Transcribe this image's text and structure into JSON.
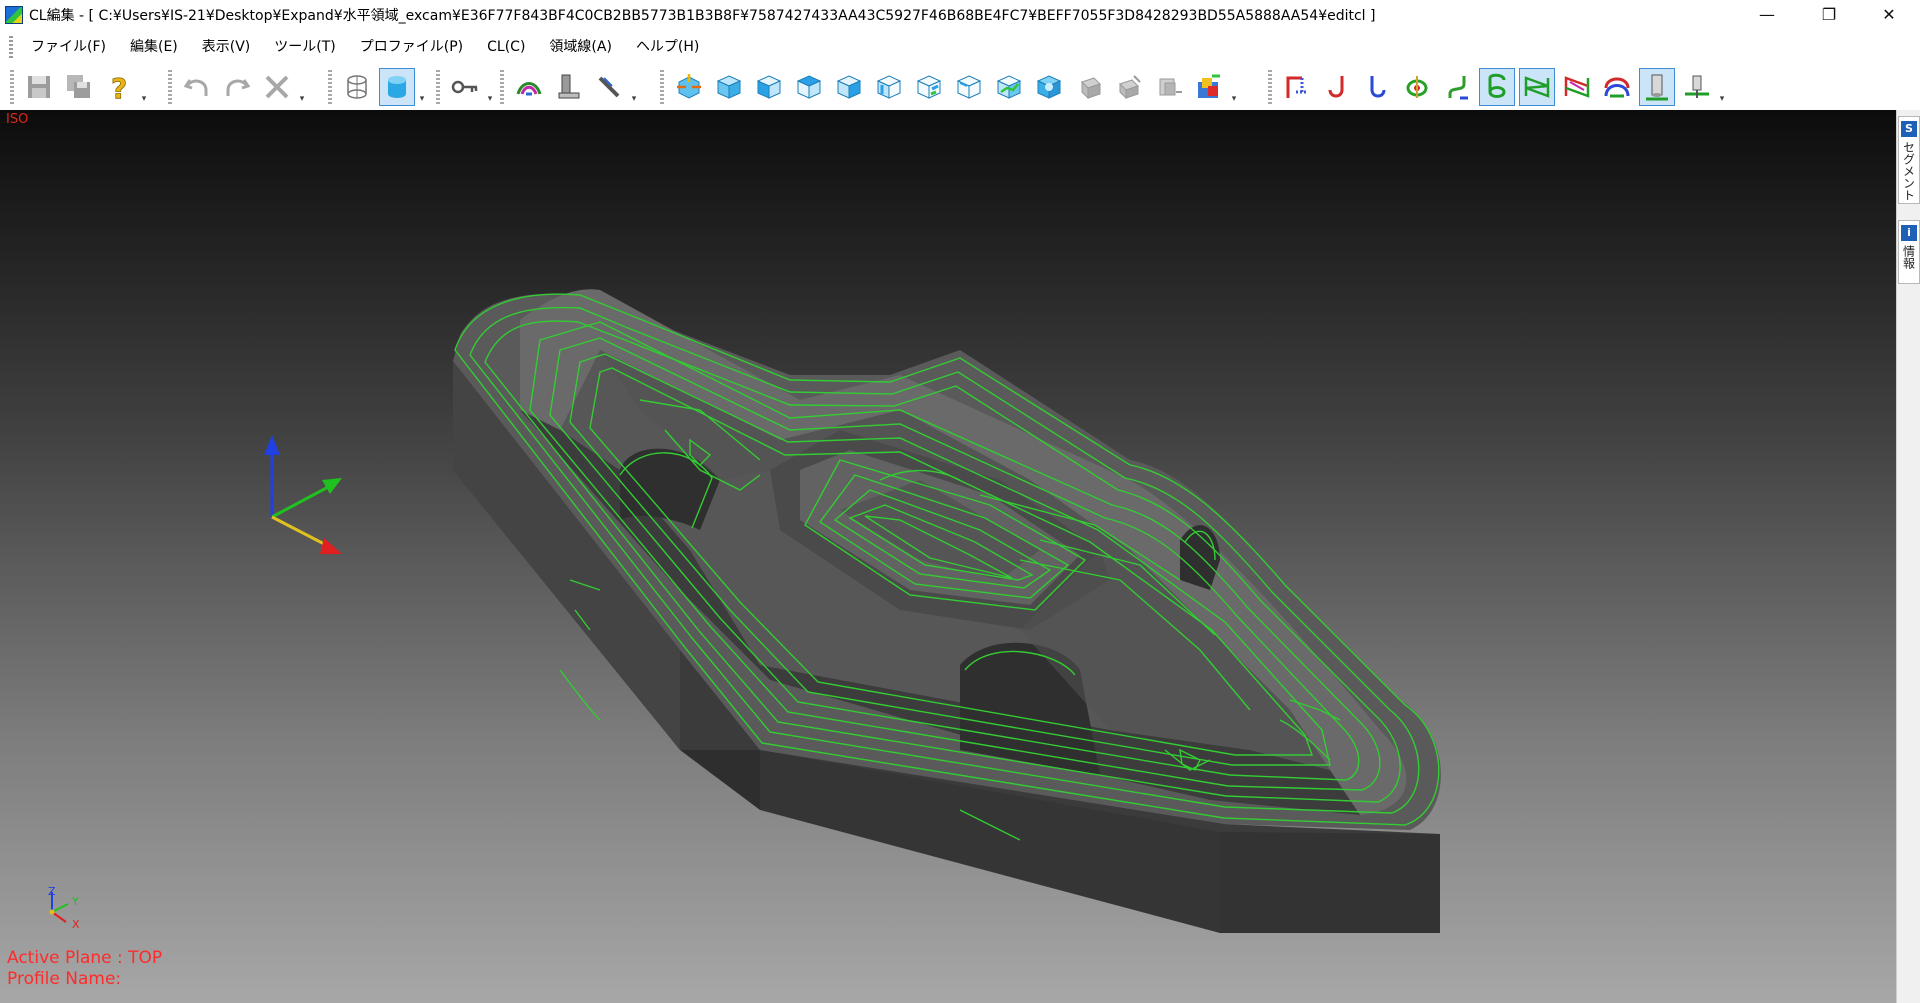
{
  "window": {
    "title": "CL編集 - [ C:¥Users¥IS-21¥Desktop¥Expand¥水平領域_excam¥E36F77F843BF4C0CB2BB5773B1B3B8F¥7587427433AA43C5927F46B68BE4FC7¥BEFF7055F3D8428293BD55A5888AA54¥editcl ]",
    "controls": [
      "—",
      "❐",
      "✕"
    ]
  },
  "menu": [
    "ファイル(F)",
    "編集(E)",
    "表示(V)",
    "ツール(T)",
    "プロファイル(P)",
    "CL(C)",
    "領域線(A)",
    "ヘルプ(H)"
  ],
  "toolbar": {
    "groups": [
      {
        "buttons": [
          {
            "icon": "save-icon"
          },
          {
            "icon": "save-all-icon"
          },
          {
            "icon": "help-icon"
          }
        ]
      },
      {
        "buttons": [
          {
            "icon": "undo-icon"
          },
          {
            "icon": "redo-icon"
          }
        ]
      },
      {
        "buttons": [
          {
            "icon": "delete-icon"
          }
        ]
      },
      {
        "buttons": [
          {
            "icon": "wireframe-cylinder-icon"
          },
          {
            "icon": "shaded-cylinder-icon",
            "active": true
          }
        ]
      },
      {
        "buttons": [
          {
            "icon": "key-icon"
          }
        ]
      },
      {
        "buttons": [
          {
            "icon": "toolpath-view-icon"
          },
          {
            "icon": "tool-holder-icon"
          },
          {
            "icon": "measure-icon"
          }
        ]
      },
      {
        "buttons": [
          {
            "icon": "view-fit-icon"
          },
          {
            "icon": "view-iso-icon"
          },
          {
            "icon": "view-front-icon"
          },
          {
            "icon": "view-top-icon"
          },
          {
            "icon": "view-right-icon"
          },
          {
            "icon": "view-left-icon"
          },
          {
            "icon": "view-back-icon"
          },
          {
            "icon": "view-bottom-icon"
          },
          {
            "icon": "view-rotate-icon"
          },
          {
            "icon": "view-shaded-icon"
          },
          {
            "icon": "view-disabled-1-icon"
          },
          {
            "icon": "view-disabled-2-icon"
          },
          {
            "icon": "view-disabled-3-icon"
          },
          {
            "icon": "color-settings-icon"
          }
        ]
      },
      {
        "buttons": [
          {
            "icon": "path-rapid-icon"
          },
          {
            "icon": "path-approach-icon"
          },
          {
            "icon": "path-retract-icon"
          },
          {
            "icon": "path-points-icon"
          },
          {
            "icon": "path-link-icon"
          },
          {
            "icon": "path-contour-icon",
            "active": true
          },
          {
            "icon": "path-zigzag-icon",
            "active": true
          },
          {
            "icon": "path-multi-icon"
          },
          {
            "icon": "path-color-icon"
          },
          {
            "icon": "tool-display-icon",
            "active": true
          },
          {
            "icon": "tool-tip-icon"
          }
        ]
      }
    ]
  },
  "viewport": {
    "view_label": "ISO",
    "active_plane_label": "Active Plane : TOP",
    "profile_name_label": "Profile Name:",
    "mini_axis": {
      "z": "Z",
      "y": "Y",
      "x": "X"
    }
  },
  "side_panel": {
    "tabs": [
      {
        "label": "セグメント",
        "icon": "segment-icon"
      },
      {
        "label": "情報",
        "icon": "info-icon"
      }
    ]
  },
  "colors": {
    "toolpath": "#33cc33",
    "view_label": "#e0261e",
    "status_text": "#ff2a2a",
    "axis_x": "#e02020",
    "axis_y": "#20c020",
    "axis_z": "#2040e0"
  }
}
